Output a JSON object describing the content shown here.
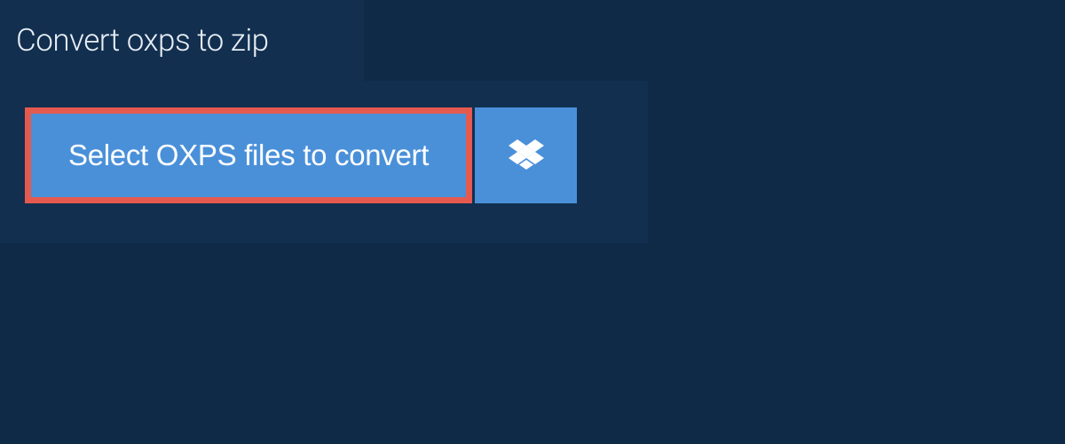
{
  "tab": {
    "label": "Convert oxps to zip"
  },
  "actions": {
    "select_label": "Select OXPS files to convert"
  },
  "colors": {
    "page_bg": "#0e2a47",
    "panel_bg": "#122f4f",
    "button_bg": "#4a90d9",
    "highlight_border": "#e55a4f"
  }
}
